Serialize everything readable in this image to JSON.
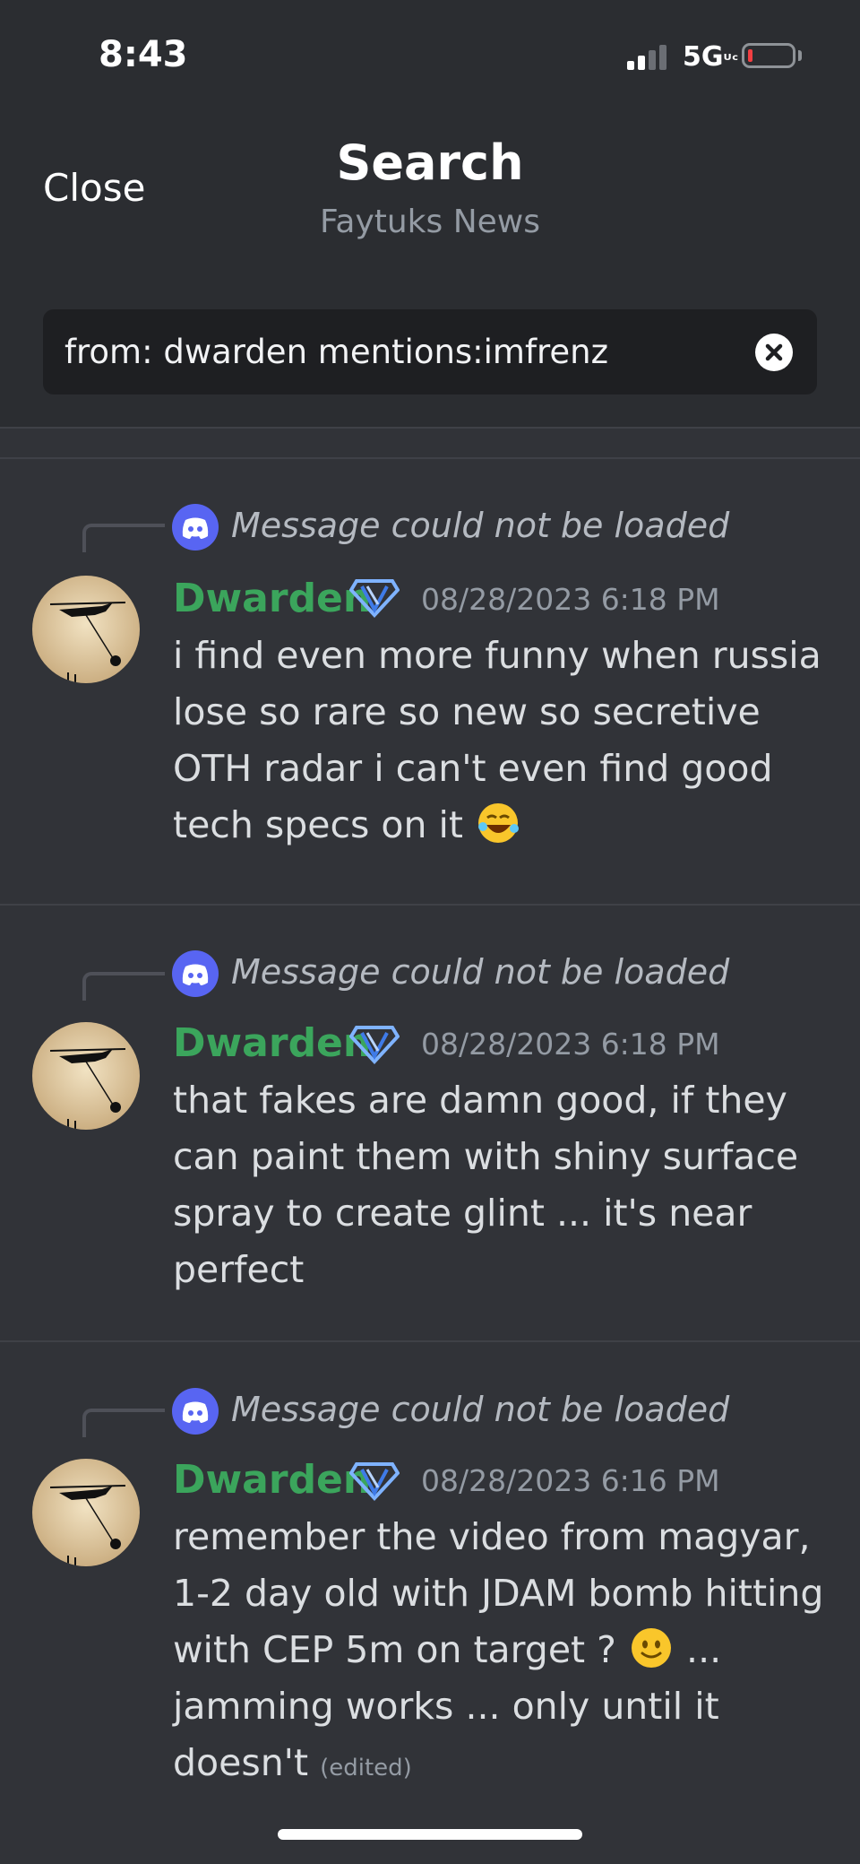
{
  "status_bar": {
    "time": "8:43",
    "network": "5G"
  },
  "header": {
    "close_label": "Close",
    "title": "Search",
    "subtitle": "Faytuks News"
  },
  "search": {
    "query": "from: dwarden mentions:imfrenz"
  },
  "messages": [
    {
      "reply_text": "Message could not be loaded",
      "author": "Dwarden",
      "timestamp": "08/28/2023 6:18 PM",
      "content": "i find even more funny when russia lose so rare so new so secretive OTH radar i can't even find good tech specs on it",
      "emoji": "rolling-on-floor-laughing"
    },
    {
      "reply_text": "Message could not be loaded",
      "author": "Dwarden",
      "timestamp": "08/28/2023 6:18 PM",
      "content": "that fakes are damn good, if they can paint them with shiny surface spray to create glint ... it's near perfect"
    },
    {
      "reply_text": "Message could not be loaded",
      "author": "Dwarden",
      "timestamp": "08/28/2023 6:16 PM",
      "content_before_emoji": "remember the video from magyar, 1-2 day old with JDAM bomb hitting with CEP 5m on target ?",
      "content_after_emoji": "... jamming works ... only until it doesn't",
      "emoji": "slightly-smiling-face",
      "edited_label": "(edited)"
    }
  ],
  "colors": {
    "background": "#313338",
    "header": "#2b2d31",
    "author": "#3ba55c",
    "blurple": "#5865f2"
  }
}
